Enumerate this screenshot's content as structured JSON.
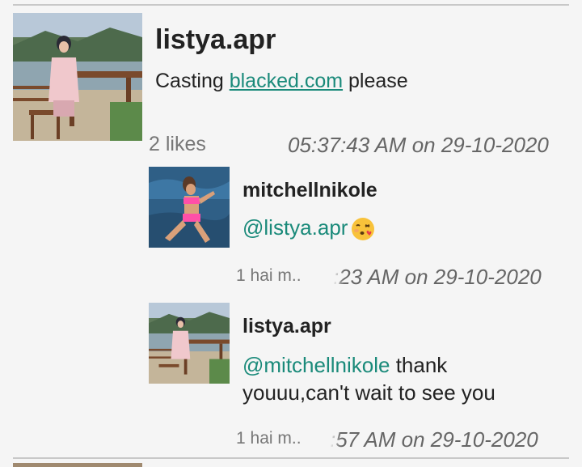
{
  "post": {
    "username": "listya.apr",
    "caption_prefix": "Casting ",
    "caption_link": "blacked.com",
    "caption_suffix": " please",
    "likes": "2 likes",
    "timestamp": "05:37:43 AM on 29-10-2020"
  },
  "replies": [
    {
      "username": "mitchellnikole",
      "mention": "@listya.apr",
      "text": "",
      "time_ago": "1 hai m..",
      "timestamp": ":23 AM on 29-10-2020"
    },
    {
      "username": "listya.apr",
      "mention": "@mitchellnikole",
      "text_line1": " thank",
      "text_line2": "youuu,can't wait to see you",
      "time_ago": "1 hai m..",
      "timestamp": ":57 AM on 29-10-2020"
    }
  ],
  "colors": {
    "link": "#1a8a7a",
    "text": "#222222",
    "muted": "#777777",
    "background": "#f5f5f5"
  },
  "icons": {
    "emoji": "kissing-face-emoji"
  }
}
